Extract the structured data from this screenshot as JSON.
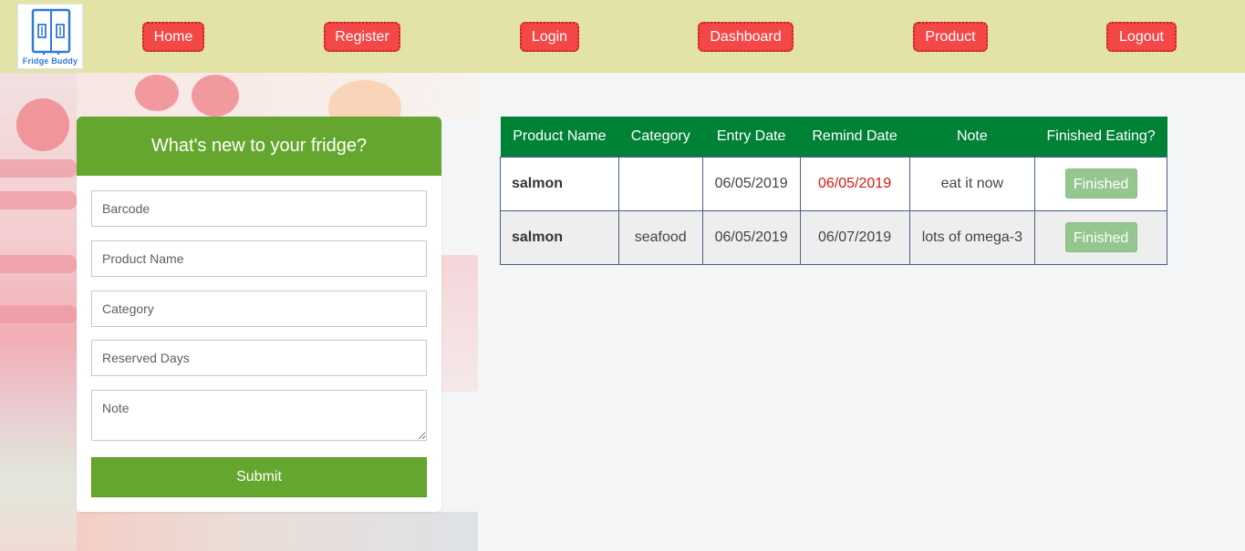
{
  "brand": {
    "logo_text": "Fridge Buddy",
    "logo_icon": "fridge-icon"
  },
  "nav": {
    "home": "Home",
    "register": "Register",
    "login": "Login",
    "dashboard": "Dashboard",
    "product": "Product",
    "logout": "Logout"
  },
  "form": {
    "title": "What's new to your fridge?",
    "barcode_placeholder": "Barcode",
    "product_name_placeholder": "Product Name",
    "category_placeholder": "Category",
    "reserved_days_placeholder": "Reserved Days",
    "note_placeholder": "Note",
    "submit_label": "Submit"
  },
  "table": {
    "headers": [
      "Product Name",
      "Category",
      "Entry Date",
      "Remind Date",
      "Note",
      "Finished Eating?"
    ],
    "rows": [
      {
        "name": "salmon",
        "category": "",
        "entry_date": "06/05/2019",
        "remind_date": "06/05/2019",
        "note": "eat it now",
        "action": "Finished"
      },
      {
        "name": "salmon",
        "category": "seafood",
        "entry_date": "06/05/2019",
        "remind_date": "06/07/2019",
        "note": "lots of omega-3",
        "action": "Finished"
      }
    ]
  },
  "colors": {
    "navbar": "#e3e3a8",
    "nav_button": "#f44848",
    "form_accent": "#65a72e",
    "table_header": "#008236",
    "overdue_date": "#d61515",
    "finished_button": "#95c690"
  }
}
